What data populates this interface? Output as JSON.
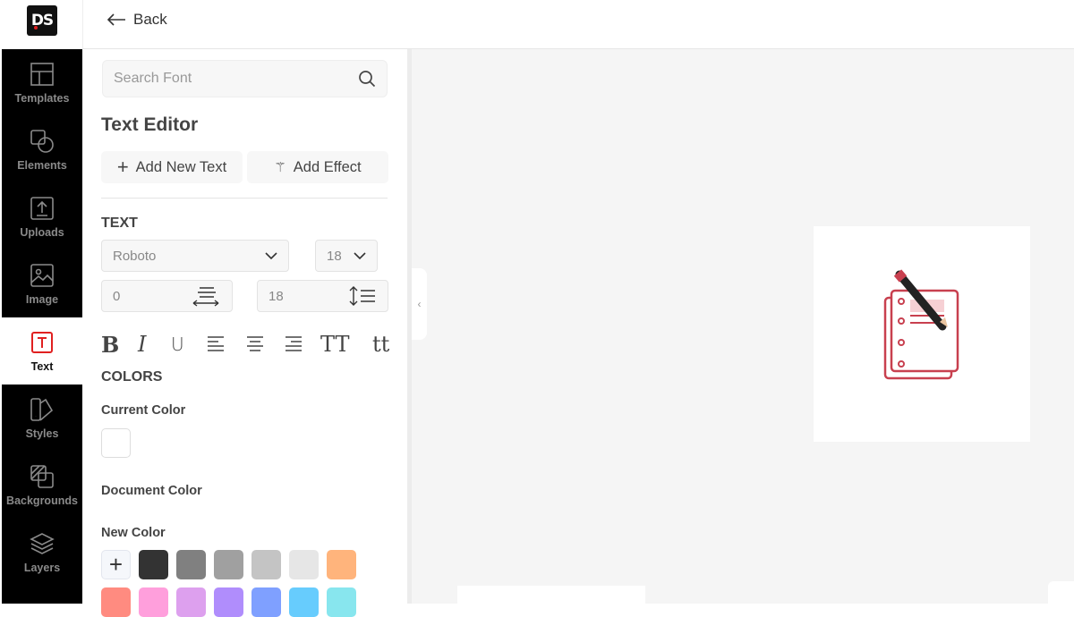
{
  "logo": "DS",
  "header": {
    "back_label": "Back"
  },
  "sidebar": {
    "items": [
      {
        "label": "Templates"
      },
      {
        "label": "Elements"
      },
      {
        "label": "Uploads"
      },
      {
        "label": "Image"
      },
      {
        "label": "Text",
        "active": true
      },
      {
        "label": "Styles"
      },
      {
        "label": "Backgrounds"
      },
      {
        "label": "Layers"
      }
    ]
  },
  "panel": {
    "search_placeholder": "Search Font",
    "title": "Text Editor",
    "add_text": "Add New Text",
    "add_effect": "Add Effect",
    "text_heading": "TEXT",
    "font": "Roboto",
    "font_size": "18",
    "letter_spacing": "0",
    "line_height": "18",
    "format": [
      "B",
      "I",
      "U",
      "TT",
      "tt"
    ],
    "colors_heading": "COLORS",
    "current_color": "Current Color",
    "document_color": "Document Color",
    "new_color": "New Color",
    "swatches": [
      "#333333",
      "#808080",
      "#a0a0a0",
      "#c4c4c4",
      "#e6e6e6",
      "#ffb47c",
      "#ff8b80",
      "#ff9fdc",
      "#dda0ee",
      "#b08dfc",
      "#7fa0ff",
      "#67ccfd",
      "#88e6ee"
    ]
  }
}
